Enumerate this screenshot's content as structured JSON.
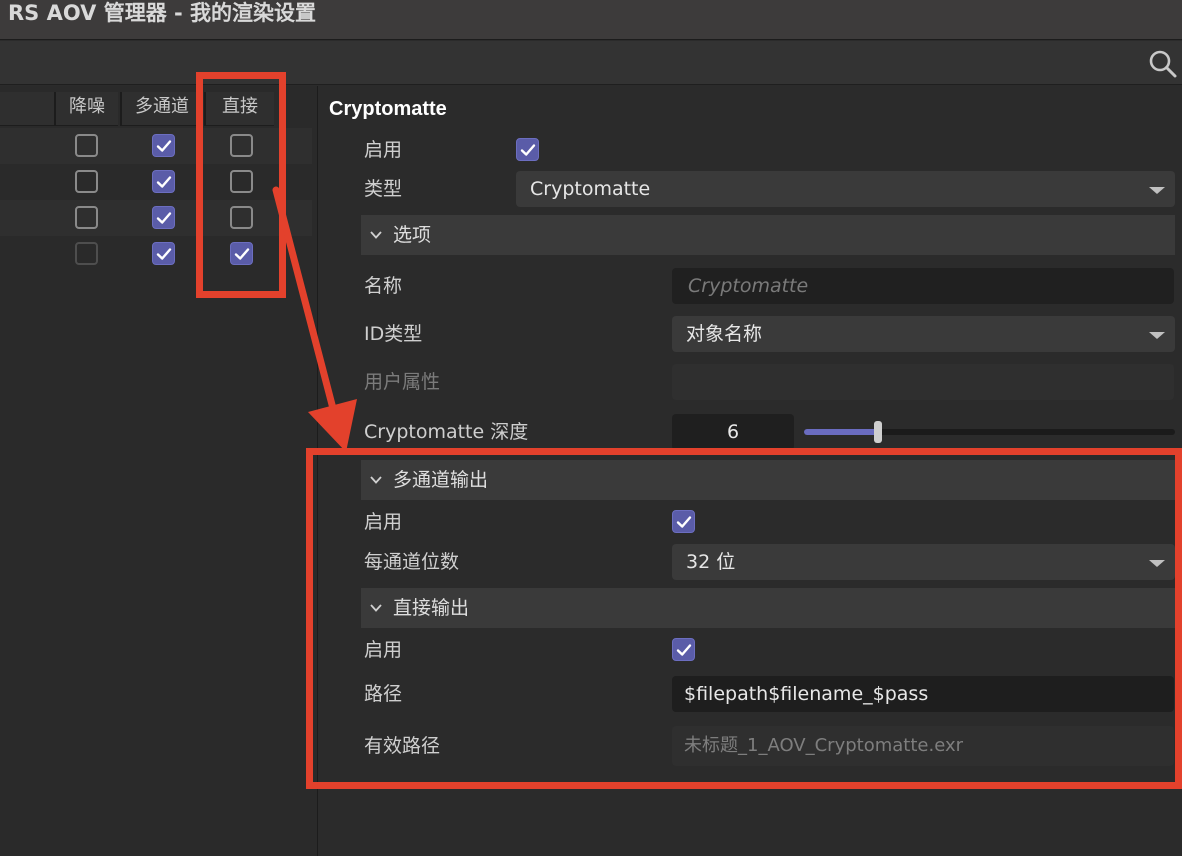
{
  "window": {
    "title": "RS AOV 管理器 - 我的渲染设置"
  },
  "toolbar": {
    "search_icon": "search-icon"
  },
  "aov_table": {
    "columns": [
      "降噪",
      "多通道",
      "直接"
    ],
    "rows": [
      {
        "denoise": false,
        "multipass": true,
        "direct": false
      },
      {
        "denoise": false,
        "multipass": true,
        "direct": false
      },
      {
        "denoise": false,
        "multipass": true,
        "direct": false
      },
      {
        "denoise": "disabled",
        "multipass": true,
        "direct": true
      }
    ]
  },
  "panel": {
    "heading": "Cryptomatte",
    "enable_label": "启用",
    "enable_checked": true,
    "type_label": "类型",
    "type_value": "Cryptomatte",
    "options_section": "选项",
    "name_label": "名称",
    "name_placeholder": "Cryptomatte",
    "id_type_label": "ID类型",
    "id_type_value": "对象名称",
    "user_attr_label": "用户属性",
    "depth_label": "Cryptomatte 深度",
    "depth_value": "6",
    "depth_slider_fraction": 0.2,
    "multipass_section": "多通道输出",
    "multipass_enable_label": "启用",
    "multipass_enable_checked": true,
    "bits_label": "每通道位数",
    "bits_value": "32 位",
    "direct_section": "直接输出",
    "direct_enable_label": "启用",
    "direct_enable_checked": true,
    "path_label": "路径",
    "path_value": "$filepath$filename_$pass",
    "effective_path_label": "有效路径",
    "effective_path_value": "未标题_1_AOV_Cryptomatte.exr"
  },
  "colors": {
    "accent": "#5a5ca8",
    "annotation": "#e3412c",
    "background": "#2b2b2b"
  }
}
